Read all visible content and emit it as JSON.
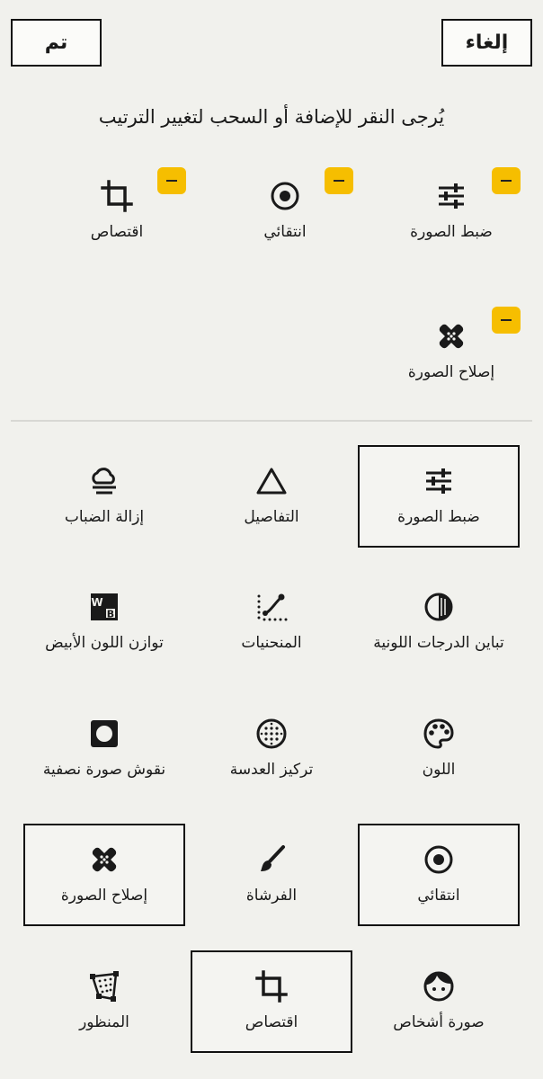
{
  "header": {
    "done_label": "تم",
    "cancel_label": "إلغاء"
  },
  "hint": "يُرجى النقر للإضافة أو السحب لتغيير الترتيب",
  "active_tools": [
    {
      "id": "tune",
      "label": "ضبط الصورة",
      "icon": "sliders-icon"
    },
    {
      "id": "selective",
      "label": "انتقائي",
      "icon": "target-icon"
    },
    {
      "id": "crop",
      "label": "اقتصاص",
      "icon": "crop-icon"
    },
    {
      "id": "healing",
      "label": "إصلاح الصورة",
      "icon": "bandage-icon"
    }
  ],
  "all_tools": [
    {
      "id": "tune",
      "label": "ضبط الصورة",
      "icon": "sliders-icon",
      "selected": true
    },
    {
      "id": "details",
      "label": "التفاصيل",
      "icon": "triangle-icon",
      "selected": false
    },
    {
      "id": "dehaze",
      "label": "إزالة الضباب",
      "icon": "cloud-fog-icon",
      "selected": false
    },
    {
      "id": "tonal",
      "label": "تباين الدرجات اللونية",
      "icon": "half-circle-icon",
      "selected": false
    },
    {
      "id": "curves",
      "label": "المنحنيات",
      "icon": "curves-icon",
      "selected": false
    },
    {
      "id": "wb",
      "label": "توازن اللون الأبيض",
      "icon": "white-balance-icon",
      "selected": false
    },
    {
      "id": "color",
      "label": "اللون",
      "icon": "palette-icon",
      "selected": false
    },
    {
      "id": "lensblur",
      "label": "تركيز العدسة",
      "icon": "dotted-circle-icon",
      "selected": false
    },
    {
      "id": "vignette",
      "label": "نقوش صورة نصفية",
      "icon": "vignette-icon",
      "selected": false
    },
    {
      "id": "selective",
      "label": "انتقائي",
      "icon": "target-icon",
      "selected": true
    },
    {
      "id": "brush",
      "label": "الفرشاة",
      "icon": "brush-icon",
      "selected": false
    },
    {
      "id": "healing",
      "label": "إصلاح الصورة",
      "icon": "bandage-icon",
      "selected": true
    },
    {
      "id": "portrait",
      "label": "صورة أشخاص",
      "icon": "face-icon",
      "selected": false
    },
    {
      "id": "crop",
      "label": "اقتصاص",
      "icon": "crop-icon",
      "selected": true
    },
    {
      "id": "perspective",
      "label": "المنظور",
      "icon": "perspective-icon",
      "selected": false
    }
  ]
}
